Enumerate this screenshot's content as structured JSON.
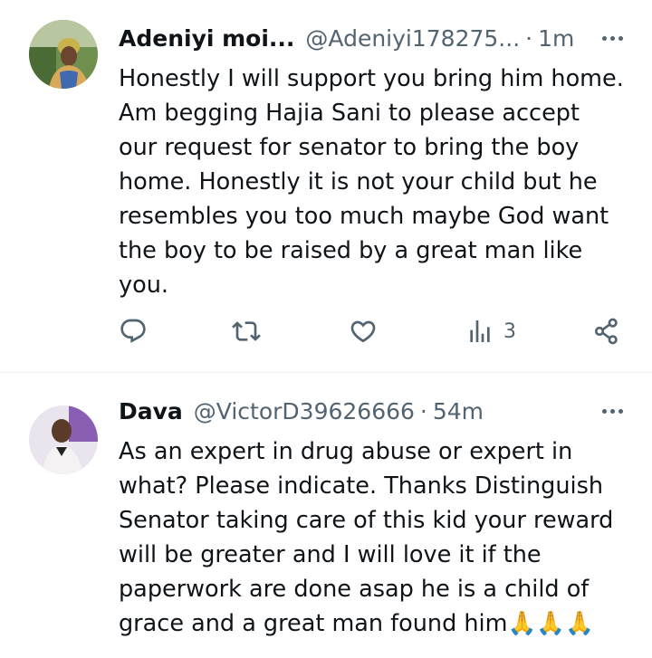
{
  "tweets": [
    {
      "name": "Adeniyi moi...",
      "handle": "@Adeniyi178275...",
      "separator": "·",
      "time": "1m",
      "text": "Honestly I will support you bring him home. Am begging Hajia Sani to please accept our request for senator to bring the boy home. Honestly it is not your child but he resembles you too much maybe God want the boy to be raised by a great man like you.",
      "views": "3",
      "icons": [
        "reply-icon",
        "retweet-icon",
        "like-icon",
        "views-icon",
        "share-icon",
        "more-icon"
      ]
    },
    {
      "name": "Dava",
      "handle": "@VictorD39626666",
      "separator": "·",
      "time": "54m",
      "text": "As an expert in drug abuse or expert in what? Please indicate. Thanks Distinguish Senator taking care of this kid your reward will be greater and I will love it if the paperwork are done asap he is a child of grace and a great man found him🙏🙏🙏",
      "icons": [
        "more-icon"
      ]
    }
  ],
  "colors": {
    "text": "#0f1419",
    "secondary": "#536471",
    "divider": "#eff3f4"
  }
}
